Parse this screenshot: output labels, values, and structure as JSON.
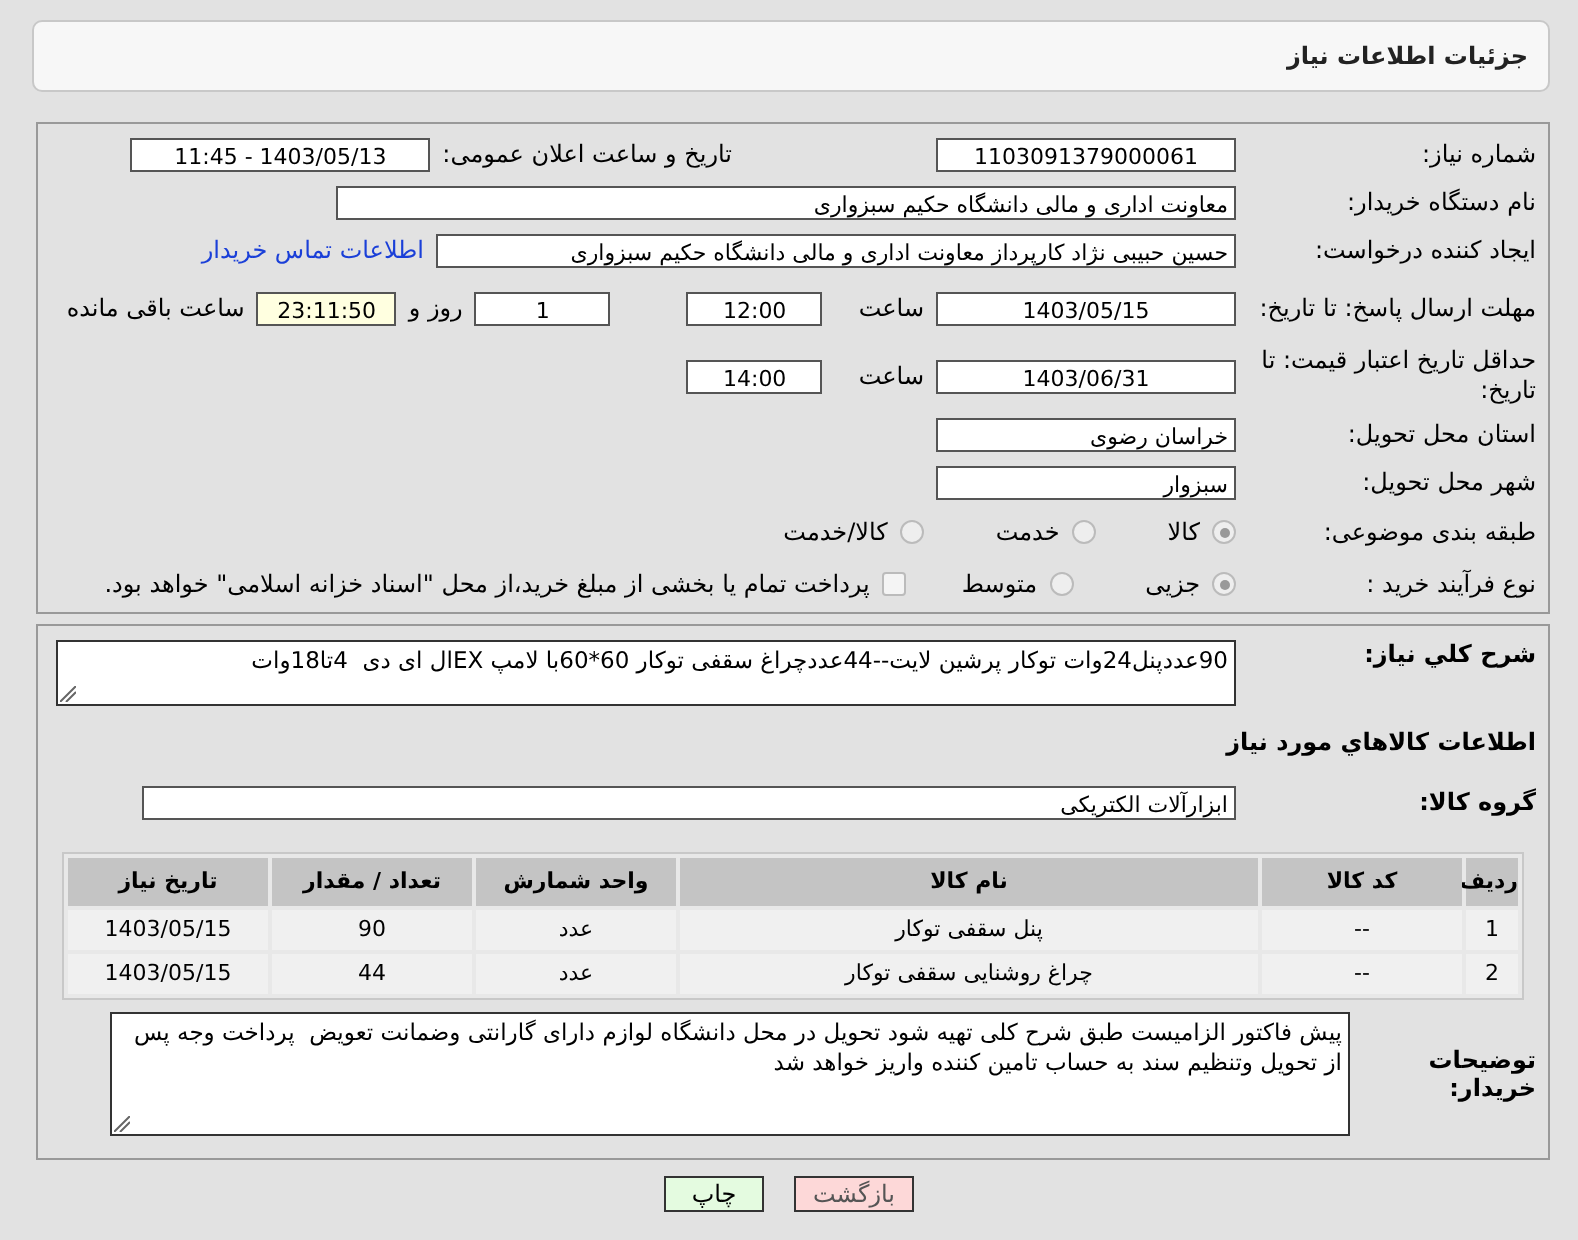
{
  "header": {
    "title": "جزئیات اطلاعات نیاز"
  },
  "need_number": {
    "label": "شماره نیاز:",
    "value": "1103091379000061"
  },
  "announce": {
    "label": "تاریخ و ساعت اعلان عمومی:",
    "value": "1403/05/13 - 11:45"
  },
  "buyer_org": {
    "label": "نام دستگاه خریدار:",
    "value": "معاونت اداری و مالی دانشگاه حکیم سبزواری"
  },
  "requester": {
    "label": "ایجاد کننده درخواست:",
    "value": "حسین حبیبی نژاد کارپرداز معاونت اداری و مالی دانشگاه حکیم سبزواری",
    "link": "اطلاعات تماس خریدار"
  },
  "reply_deadline": {
    "label": "مهلت ارسال پاسخ: تا تاریخ:",
    "date": "1403/05/15",
    "time_label": "ساعت",
    "time": "12:00",
    "days": "1",
    "days_label": "روز و",
    "remaining": "23:11:50",
    "remaining_label": "ساعت باقی مانده"
  },
  "price_validity": {
    "label": "حداقل تاریخ اعتبار قیمت: تا تاریخ:",
    "date": "1403/06/31",
    "time_label": "ساعت",
    "time": "14:00"
  },
  "province": {
    "label": "استان محل تحویل:",
    "value": "خراسان رضوی"
  },
  "city": {
    "label": "شهر محل تحویل:",
    "value": "سبزوار"
  },
  "category": {
    "label": "طبقه بندی موضوعی:",
    "options": [
      {
        "label": "کالا",
        "selected": true
      },
      {
        "label": "خدمت",
        "selected": false
      },
      {
        "label": "کالا/خدمت",
        "selected": false
      }
    ]
  },
  "purchase_type": {
    "label": "نوع فرآیند خرید :",
    "options": [
      {
        "label": "جزیی",
        "selected": true
      },
      {
        "label": "متوسط",
        "selected": false
      }
    ],
    "treasury": {
      "checked": false,
      "label": "پرداخت تمام یا بخشی از مبلغ خرید،از محل \"اسناد خزانه اسلامی\" خواهد بود."
    }
  },
  "description": {
    "label": "شرح کلي نياز:",
    "value": "90عددپنل24وات توکار پرشین لایت--44عددچراغ سقفی توکار 60*60با لامپ EXال ای دی  4تا18وات"
  },
  "goods_heading": "اطلاعات کالاهاي مورد نياز",
  "goods_group": {
    "label": "گروه کالا:",
    "value": "ابزارآلات الکتریکی"
  },
  "table": {
    "columns": [
      "ردیف",
      "کد کالا",
      "نام کالا",
      "واحد شمارش",
      "تعداد / مقدار",
      "تاریخ نیاز"
    ],
    "rows": [
      [
        "1",
        "--",
        "پنل سقفی توکار",
        "عدد",
        "90",
        "1403/05/15"
      ],
      [
        "2",
        "--",
        "چراغ روشنایی سقفی توکار",
        "عدد",
        "44",
        "1403/05/15"
      ]
    ]
  },
  "buyer_notes": {
    "label": "توضیحات خریدار:",
    "value": "پیش فاکتور الزامیست طبق شرح کلی تهیه شود تحویل در محل دانشگاه لوازم دارای گارانتی وضمانت تعویض  پرداخت وجه پس از تحویل وتنظیم سند به حساب تامین کننده واریز خواهد شد"
  },
  "buttons": [
    {
      "label": "بازگشت",
      "kind": "back"
    },
    {
      "label": "چاپ",
      "kind": "print"
    }
  ]
}
